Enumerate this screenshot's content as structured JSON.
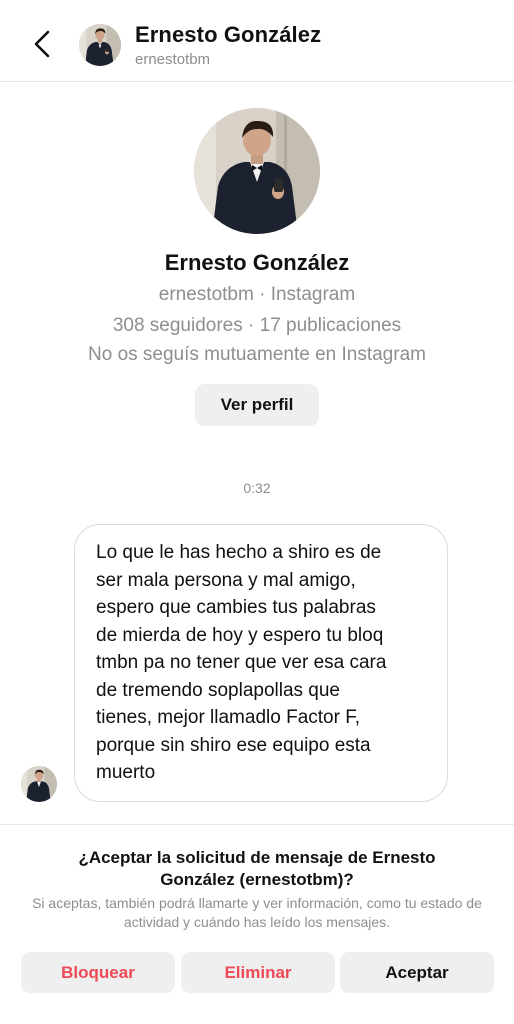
{
  "header": {
    "name": "Ernesto González",
    "username": "ernestotbm"
  },
  "profile": {
    "name": "Ernesto González",
    "source_line": "ernestotbm · Instagram",
    "stats_line": "308 seguidores · 17 publicaciones",
    "relationship_line": "No os seguís mutuamente en Instagram",
    "view_profile_label": "Ver perfil"
  },
  "conversation": {
    "timestamp": "0:32",
    "message": "Lo que le has hecho a shiro es de\nser mala persona y mal amigo,\nespero que cambies tus palabras\nde mierda de hoy y espero tu bloq\ntmbn pa no tener que ver esa cara\nde tremendo soplapollas que\ntienes, mejor llamadlo Factor F,\nporque sin shiro ese equipo esta\nmuerto"
  },
  "request": {
    "title": "¿Aceptar la solicitud de mensaje de Ernesto González (ernestotbm)?",
    "description": "Si aceptas, también podrá llamarte y ver información, como tu estado de actividad y cuándo has leído los mensajes.",
    "block_label": "Bloquear",
    "delete_label": "Eliminar",
    "accept_label": "Aceptar"
  },
  "colors": {
    "destructive": "#ed4956",
    "secondary_text": "#8e8e8e",
    "button_bg": "#efefef",
    "divider": "#e6e6e6"
  },
  "icons": {
    "back": "chevron-left-icon"
  }
}
